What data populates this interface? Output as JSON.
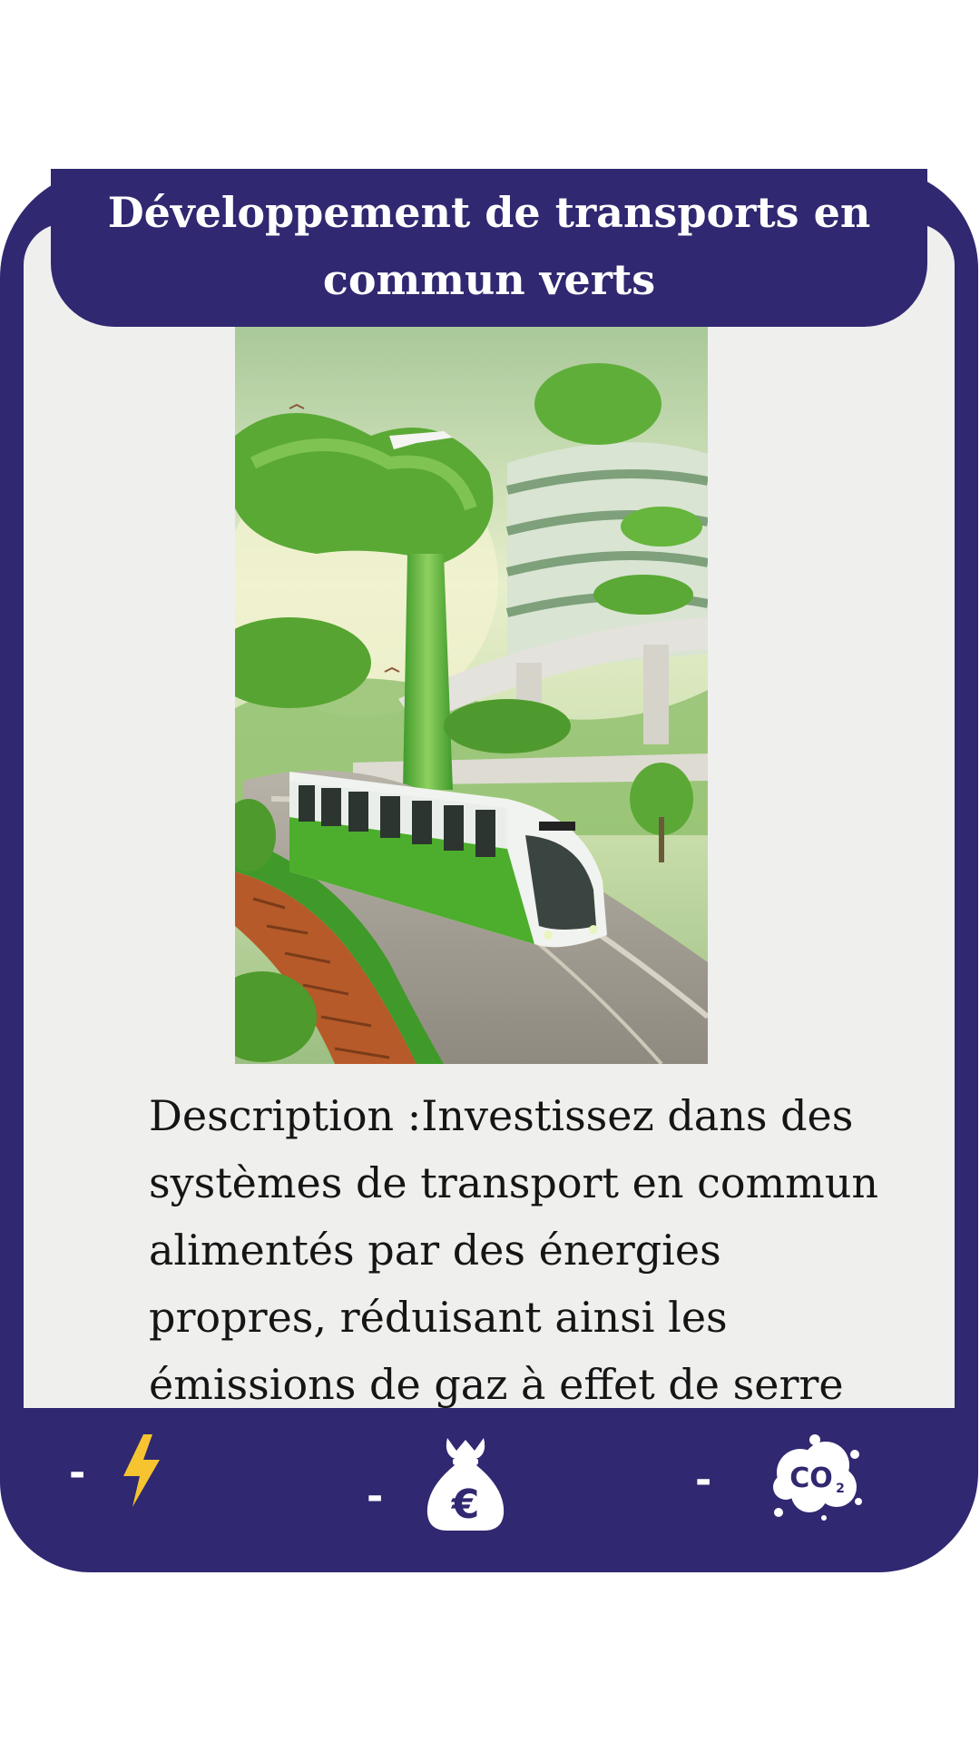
{
  "card": {
    "title": "Développement de transports en commun verts",
    "description": "Description :Investissez dans des systèmes de transport en commun alimentés par des énergies propres, réduisant ainsi les émissions de gaz à effet de serre",
    "illustration_icon": "green-city-tram-illustration"
  },
  "stats": [
    {
      "name": "energy",
      "icon": "lightning-icon",
      "value": "-"
    },
    {
      "name": "money",
      "icon": "euro-money-bag-icon",
      "value": "-"
    },
    {
      "name": "co2",
      "icon": "co2-cloud-icon",
      "value": "-"
    }
  ],
  "colors": {
    "frame": "#302870",
    "panel": "#efefee",
    "lightning": "#f6c431",
    "icon_white": "#ffffff",
    "text": "#151515"
  }
}
